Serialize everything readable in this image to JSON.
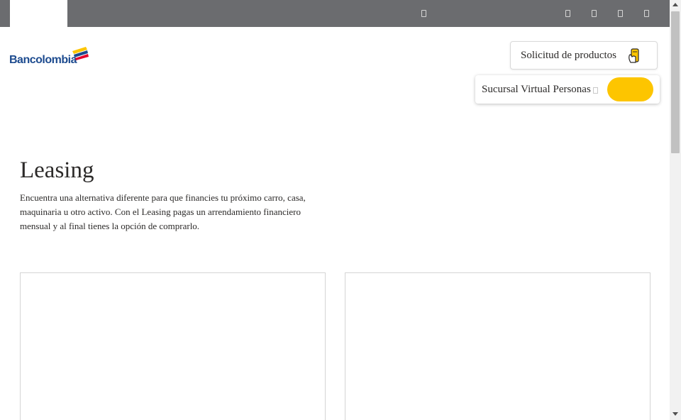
{
  "brand": {
    "name": "Bancolombia",
    "colors": {
      "blue": "#1d4b8f",
      "yellow": "#fdc500",
      "red": "#e4002b",
      "topbar": "#6b6c6f"
    }
  },
  "header": {
    "solicitud_label": "Solicitud de productos",
    "solicitud_icon": "hand-phone-icon",
    "sucursal_label": "Sucursal Virtual Personas"
  },
  "main": {
    "title": "Leasing",
    "description": "Encuentra una alternativa diferente para que financies tu próximo carro, casa, maquinaria u otro activo. Con el Leasing pagas un arrendamiento financiero mensual y al final tienes la opción de comprarlo."
  }
}
